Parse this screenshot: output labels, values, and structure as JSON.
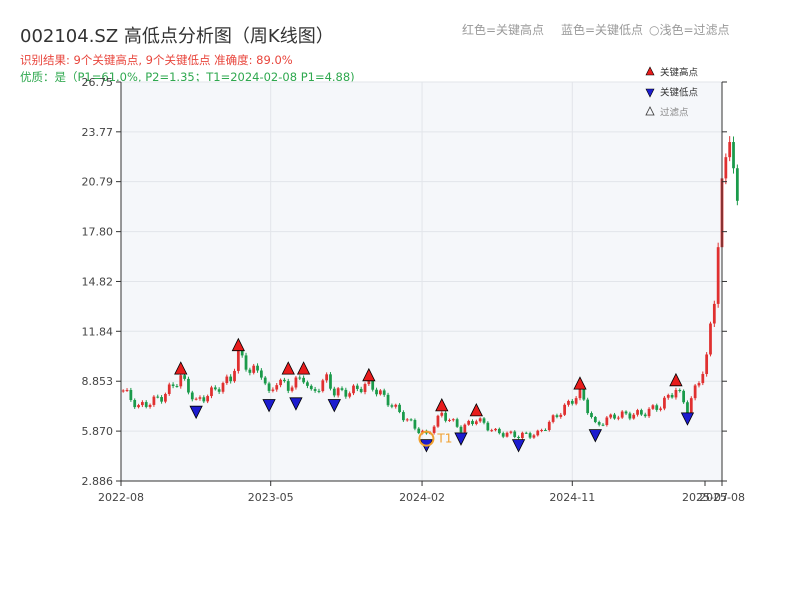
{
  "header": {
    "title": "002104.SZ 高低点分析图（周K线图）",
    "result_line": "识别结果: 9个关键高点, 9个关键低点 准确度: 89.0%",
    "quality_line": "优质：是（P1=61.0%, P2=1.35；T1=2024-02-08 P1=4.88)",
    "legend_red": "红色=关键高点",
    "legend_blue": "蓝色=关键低点",
    "legend_light": "○浅色=过滤点"
  },
  "colors": {
    "up": "#e03030",
    "down": "#1a9a4a",
    "high_marker": "#e81c1c",
    "low_marker": "#1c1ccf",
    "t1_marker": "#f0a030",
    "plot_bg": "#f5f7fa",
    "grid": "#e2e5ea"
  },
  "chart_data": {
    "type": "candlestick",
    "title": "002104.SZ 高低点分析图（周K线图）",
    "y_ticks": [
      "2.886",
      "5.870",
      "8.853",
      "11.84",
      "14.82",
      "17.80",
      "20.79",
      "23.77",
      "26.75"
    ],
    "ylim": [
      2.886,
      26.75
    ],
    "x_ticks": [
      {
        "label": "2022-08",
        "date": "2022-08"
      },
      {
        "label": "2023-05",
        "date": "2023-05"
      },
      {
        "label": "2024-02",
        "date": "2024-02"
      },
      {
        "label": "2024-11",
        "date": "2024-11"
      },
      {
        "label": "2025-07",
        "date": "2025-07"
      },
      {
        "label": "2025-08",
        "date": "2025-08"
      }
    ],
    "xlim": [
      "2022-08",
      "2025-08"
    ],
    "grid": true,
    "legend": [
      {
        "label": "关键高点",
        "marker": "triangle-up",
        "color": "#e81c1c"
      },
      {
        "label": "关键低点",
        "marker": "triangle-down",
        "color": "#1c1ccf"
      },
      {
        "label": "过滤点",
        "marker": "triangle-up-outline",
        "color": "#888888"
      }
    ],
    "legend_position": "top-right",
    "price_path": [
      [
        "2022-08-05",
        8.3
      ],
      [
        "2022-09-02",
        7.3
      ],
      [
        "2022-10-14",
        7.9
      ],
      [
        "2022-11-04",
        8.6
      ],
      [
        "2022-11-18",
        9.1
      ],
      [
        "2022-12-16",
        7.6
      ],
      [
        "2023-01-13",
        8.2
      ],
      [
        "2023-02-17",
        9.0
      ],
      [
        "2023-03-03",
        10.5
      ],
      [
        "2023-03-24",
        9.5
      ],
      [
        "2023-04-14",
        9.4
      ],
      [
        "2023-04-28",
        8.0
      ],
      [
        "2023-05-12",
        8.9
      ],
      [
        "2023-06-02",
        8.5
      ],
      [
        "2023-06-30",
        9.1
      ],
      [
        "2023-07-14",
        8.1
      ],
      [
        "2023-08-11",
        9.0
      ],
      [
        "2023-08-25",
        8.2
      ],
      [
        "2023-09-22",
        8.2
      ],
      [
        "2023-10-27",
        8.7
      ],
      [
        "2023-11-17",
        8.1
      ],
      [
        "2023-12-15",
        7.2
      ],
      [
        "2024-01-19",
        6.1
      ],
      [
        "2024-02-09",
        5.6
      ],
      [
        "2024-03-08",
        6.9
      ],
      [
        "2024-04-12",
        6.0
      ],
      [
        "2024-05-10",
        6.6
      ],
      [
        "2024-06-14",
        5.8
      ],
      [
        "2024-07-26",
        5.6
      ],
      [
        "2024-08-30",
        5.7
      ],
      [
        "2024-09-27",
        6.6
      ],
      [
        "2024-10-25",
        7.5
      ],
      [
        "2024-11-15",
        8.2
      ],
      [
        "2024-12-13",
        6.2
      ],
      [
        "2025-01-17",
        6.8
      ],
      [
        "2025-03-07",
        6.9
      ],
      [
        "2025-04-11",
        7.4
      ],
      [
        "2025-05-09",
        8.4
      ],
      [
        "2025-05-30",
        7.2
      ],
      [
        "2025-06-20",
        8.9
      ],
      [
        "2025-07-04",
        10.2
      ],
      [
        "2025-07-18",
        13.9
      ],
      [
        "2025-08-01",
        20.3
      ],
      [
        "2025-08-15",
        24.0
      ],
      [
        "2025-08-29",
        19.0
      ]
    ],
    "key_highs": [
      {
        "date": "2022-11-18",
        "value": 9.1
      },
      {
        "date": "2023-03-03",
        "value": 10.5
      },
      {
        "date": "2023-06-02",
        "value": 9.1
      },
      {
        "date": "2023-06-30",
        "value": 9.1
      },
      {
        "date": "2023-10-27",
        "value": 8.7
      },
      {
        "date": "2024-03-08",
        "value": 6.9
      },
      {
        "date": "2024-05-10",
        "value": 6.6
      },
      {
        "date": "2024-11-15",
        "value": 8.2
      },
      {
        "date": "2025-05-09",
        "value": 8.4
      }
    ],
    "key_lows": [
      {
        "date": "2022-12-16",
        "value": 7.6
      },
      {
        "date": "2023-04-28",
        "value": 8.0
      },
      {
        "date": "2023-06-16",
        "value": 8.1
      },
      {
        "date": "2023-08-25",
        "value": 8.0
      },
      {
        "date": "2024-02-09",
        "value": 5.6
      },
      {
        "date": "2024-04-12",
        "value": 6.0
      },
      {
        "date": "2024-07-26",
        "value": 5.6
      },
      {
        "date": "2024-12-13",
        "value": 6.2
      },
      {
        "date": "2025-05-30",
        "value": 7.2
      }
    ],
    "t1_point": {
      "label": "T1",
      "date": "2024-02-09",
      "value": 5.6
    }
  }
}
